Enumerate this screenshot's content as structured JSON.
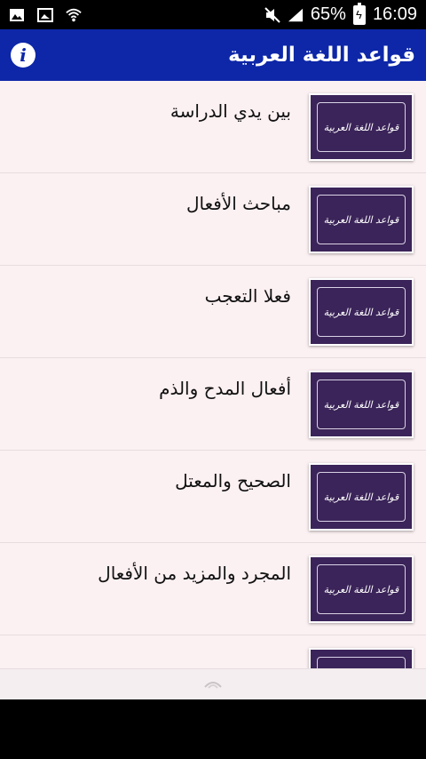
{
  "status_bar": {
    "battery_percent": "65%",
    "time": "16:09",
    "left_icons": [
      "image-icon",
      "gallery-icon",
      "wifi-icon"
    ],
    "right_icons": [
      "mute-icon",
      "signal-icon",
      "battery-icon"
    ]
  },
  "app_bar": {
    "title": "قواعد اللغة العربية",
    "info_glyph": "i",
    "background": "#0d27a8"
  },
  "list": {
    "thumbnail_label": "قواعد اللغة العربية",
    "items": [
      {
        "title": "بين يدي الدراسة"
      },
      {
        "title": "مباحث الأفعال"
      },
      {
        "title": "فعلا التعجب"
      },
      {
        "title": "أفعال المدح والذم"
      },
      {
        "title": "الصحيح والمعتل"
      },
      {
        "title": "المجرد والمزيد من الأفعال"
      },
      {
        "title": ""
      }
    ]
  },
  "colors": {
    "list_background": "#fbf0f2",
    "thumbnail_background": "#3b2459"
  }
}
